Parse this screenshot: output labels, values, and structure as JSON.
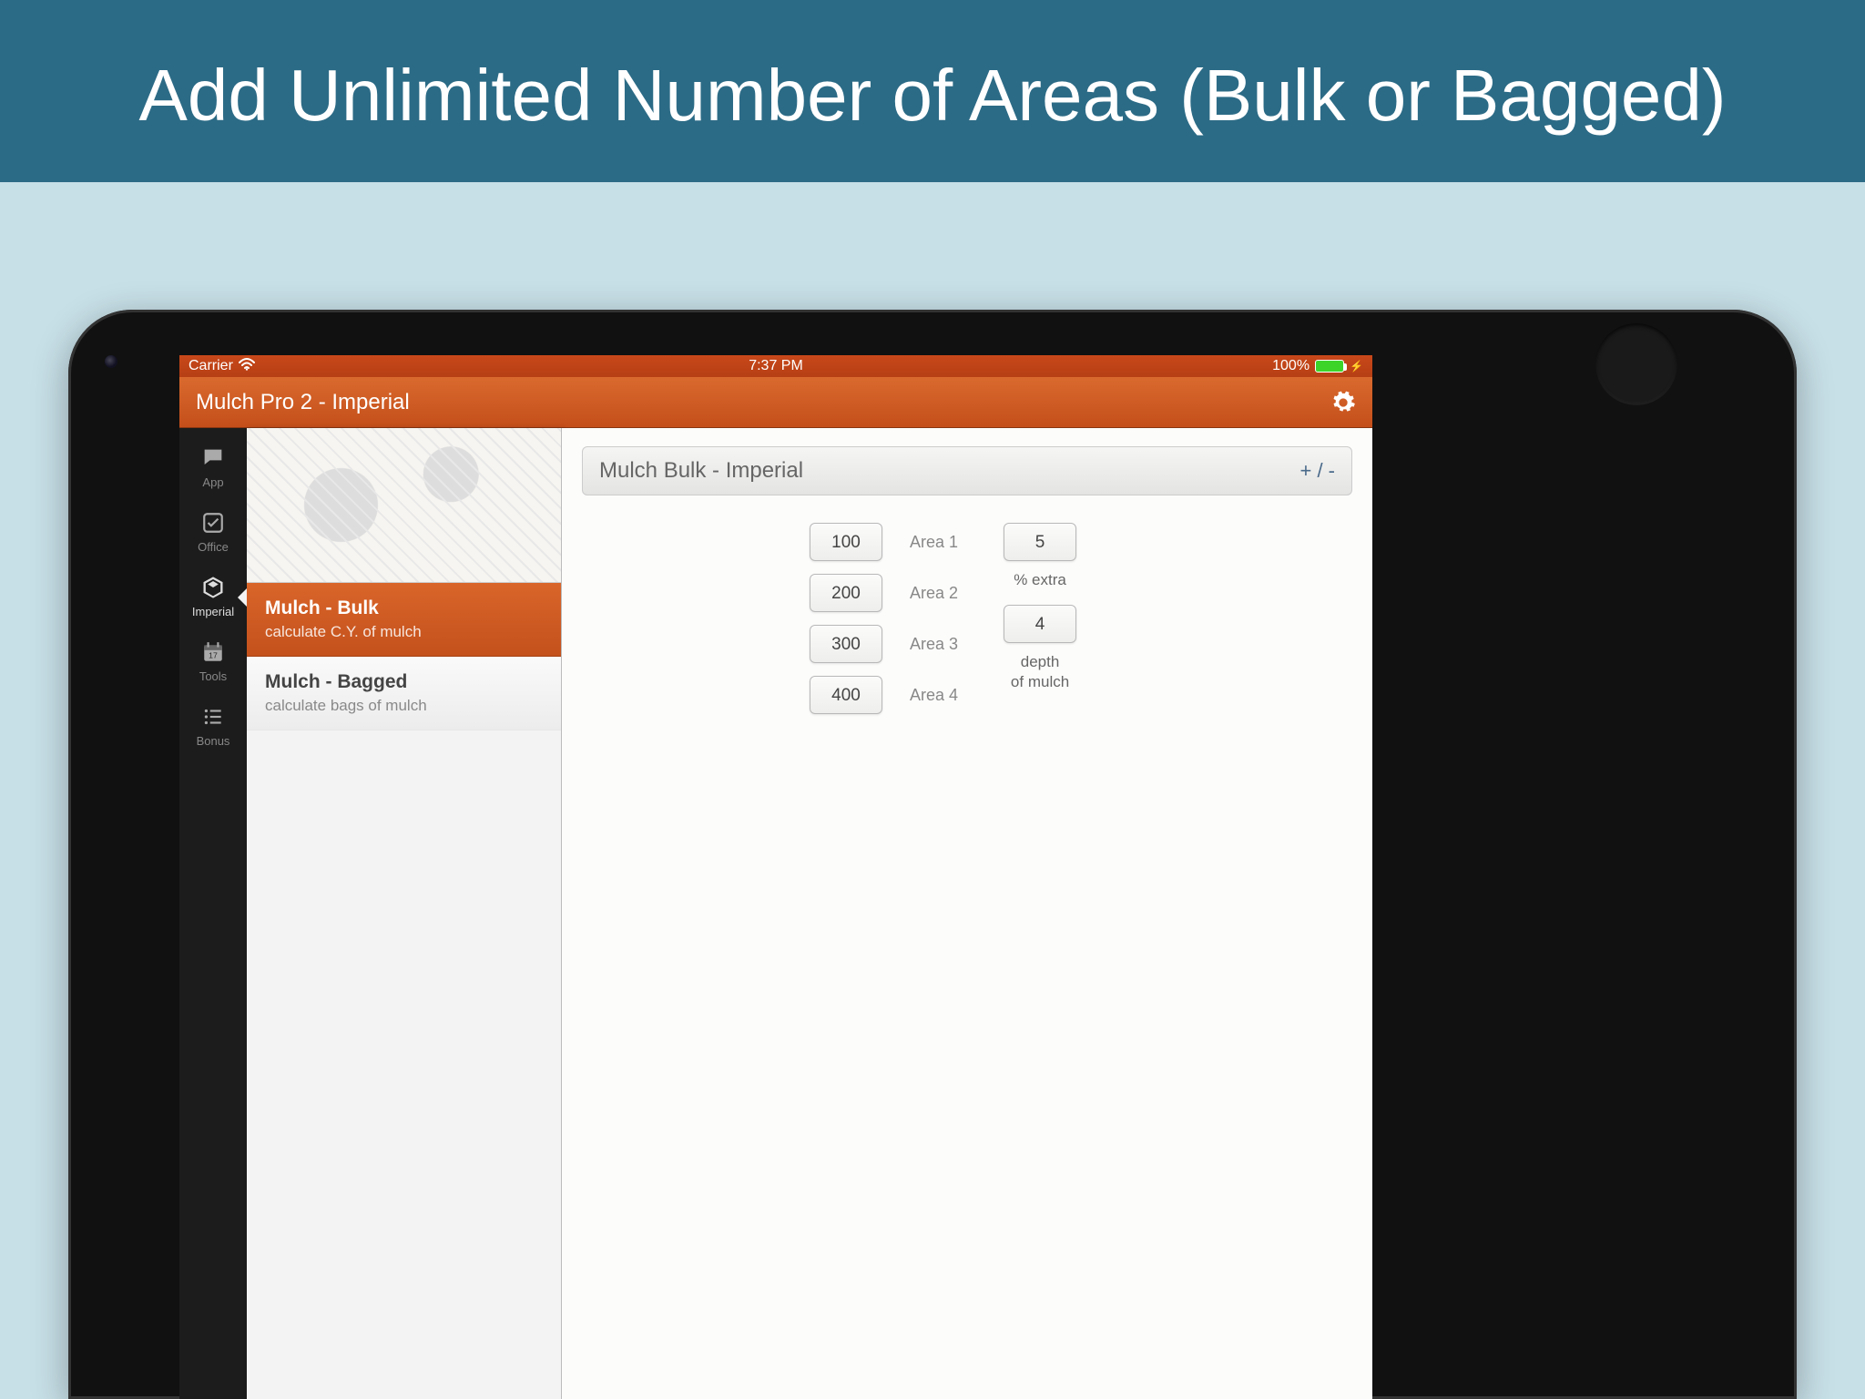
{
  "promo": "Add Unlimited Number of Areas (Bulk or Bagged)",
  "statusbar": {
    "carrier": "Carrier",
    "time": "7:37 PM",
    "battery": "100%"
  },
  "navbar": {
    "title": "Mulch Pro 2 - Imperial"
  },
  "sidebar": {
    "items": [
      {
        "label": "App"
      },
      {
        "label": "Office"
      },
      {
        "label": "Imperial"
      },
      {
        "label": "Tools"
      },
      {
        "label": "Bonus"
      }
    ]
  },
  "menu": {
    "items": [
      {
        "title": "Mulch - Bulk",
        "sub": "calculate C.Y. of mulch",
        "active": true
      },
      {
        "title": "Mulch - Bagged",
        "sub": "calculate bags of mulch",
        "active": false
      }
    ]
  },
  "detail": {
    "title": "Mulch Bulk - Imperial",
    "action": "+ / -",
    "areas": [
      {
        "value": "100",
        "label": "Area 1"
      },
      {
        "value": "200",
        "label": "Area 2"
      },
      {
        "value": "300",
        "label": "Area 3"
      },
      {
        "value": "400",
        "label": "Area 4"
      }
    ],
    "extra": {
      "value": "5",
      "label": "% extra"
    },
    "depth": {
      "value": "4",
      "label": "depth\nof mulch"
    }
  }
}
